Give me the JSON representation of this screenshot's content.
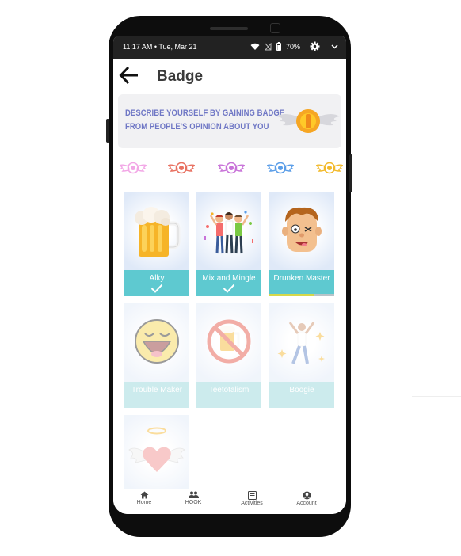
{
  "status_bar": {
    "time_date": "11:17 AM • Tue, Mar 21",
    "battery": "70%",
    "icons": [
      "wifi-icon",
      "no-signal-icon",
      "battery-icon",
      "settings-gear-icon",
      "chevron-down-icon"
    ]
  },
  "app_bar": {
    "back_icon": "arrow-left-icon",
    "title": "Badge"
  },
  "banner": {
    "line1": "DESCRIBE YOURSELF BY GAINING BADGE",
    "line2": "FROM PEOPLE'S OPINION ABOUT YOU",
    "text_color": "#6f77c5"
  },
  "badge_filters": [
    {
      "name": "pink",
      "color": "#f2a6e6"
    },
    {
      "name": "red",
      "color": "#e87060"
    },
    {
      "name": "violet",
      "color": "#c872d8"
    },
    {
      "name": "blue",
      "color": "#5a9de8"
    },
    {
      "name": "yellow",
      "color": "#f2b92a"
    }
  ],
  "badges": [
    {
      "label": "Alky",
      "earned": true,
      "illustration": "beer-mug"
    },
    {
      "label": "Mix and Mingle",
      "earned": true,
      "illustration": "party-friends"
    },
    {
      "label": "Drunken Master",
      "earned": false,
      "progress": 0.68,
      "illustration": "drunk-face"
    },
    {
      "label": "Trouble Maker",
      "locked": true,
      "illustration": "laughing-face"
    },
    {
      "label": "Teetotalism",
      "locked": true,
      "illustration": "no-beer"
    },
    {
      "label": "Boogie",
      "locked": true,
      "illustration": "dancer"
    },
    {
      "label": "",
      "locked": true,
      "illustration": "angel-heart"
    }
  ],
  "bottom_nav": [
    {
      "label": "Home",
      "icon": "home-icon"
    },
    {
      "label": "HOOK",
      "icon": "people-icon"
    },
    {
      "label": "Activities",
      "icon": "list-icon"
    },
    {
      "label": "Account",
      "icon": "account-icon"
    }
  ],
  "colors": {
    "accent": "#5ec9d0",
    "progress_yellow": "#d6d84a",
    "status_bar": "#222222"
  }
}
